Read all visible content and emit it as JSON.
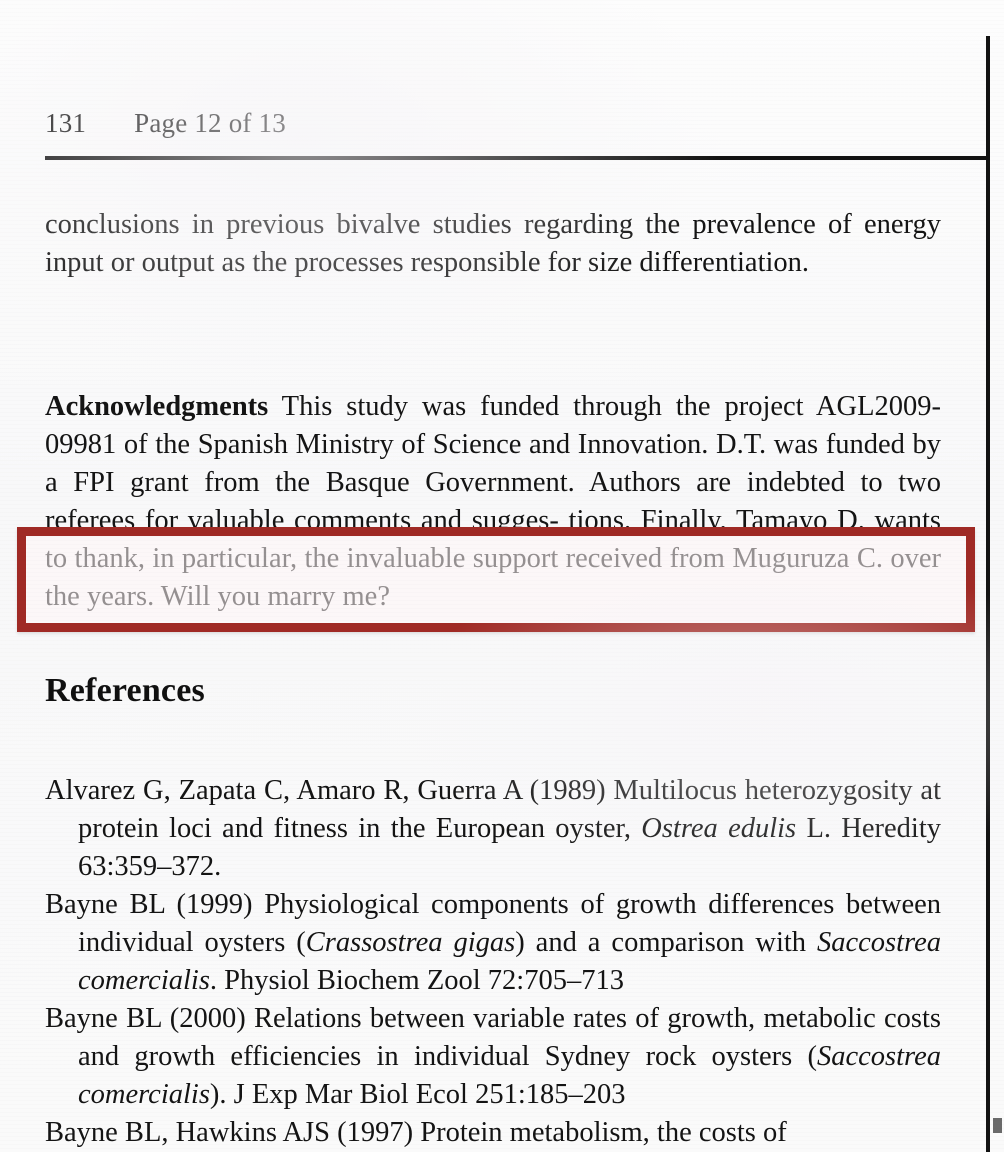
{
  "document": {
    "running_head": {
      "folio": "131",
      "page_indicator": "Page 12 of 13"
    },
    "body": {
      "paragraph_conclusions": "conclusions in previous bivalve studies regarding the prevalence of energy input or output as the processes responsible for size differentiation.",
      "acknowledgments": {
        "runin_label": "Acknowledgments",
        "text_before_highlight": " This study was funded through the project AGL2009-09981 of the Spanish Ministry of Science and Innovation. D.T. was funded by a FPI grant from the Basque Government. Authors are indebted to two referees for valuable comments and sugges-",
        "highlighted_text": "tions. Finally, Tamayo D. wants to thank, in particular, the invaluable support received from Muguruza C. over the years. Will you marry me?"
      }
    },
    "references": {
      "heading": "References",
      "items": [
        {
          "parts": [
            {
              "text": "Alvarez G, Zapata C, Amaro R, Guerra A (1989) Multilocus heterozygosity at protein loci and fitness in the European oyster, ",
              "style": "roman"
            },
            {
              "text": "Ostrea edulis",
              "style": "italic"
            },
            {
              "text": " L. Heredity 63:359–372.",
              "style": "roman"
            }
          ]
        },
        {
          "parts": [
            {
              "text": "Bayne BL (1999) Physiological components of growth differences between individual oysters (",
              "style": "roman"
            },
            {
              "text": "Crassostrea gigas",
              "style": "italic"
            },
            {
              "text": ") and a comparison with ",
              "style": "roman"
            },
            {
              "text": "Saccostrea comercialis",
              "style": "italic"
            },
            {
              "text": ". Physiol Biochem Zool 72:705–713",
              "style": "roman"
            }
          ]
        },
        {
          "parts": [
            {
              "text": "Bayne BL (2000) Relations between variable rates of growth, metabolic costs and growth efficiencies in individual Sydney rock oysters (",
              "style": "roman"
            },
            {
              "text": "Saccostrea comercialis",
              "style": "italic"
            },
            {
              "text": "). J Exp Mar Biol Ecol 251:185–203",
              "style": "roman"
            }
          ]
        },
        {
          "parts": [
            {
              "text": "Bayne BL, Hawkins AJS (1997) Protein metabolism, the costs of",
              "style": "roman"
            }
          ]
        }
      ]
    },
    "annotation": {
      "highlight_border_color": "#a02a25",
      "highlight_fill_color": "#fff6f7"
    },
    "colors": {
      "paper": "#fbfbfb",
      "ink": "#141414",
      "rule": "#131313"
    }
  }
}
